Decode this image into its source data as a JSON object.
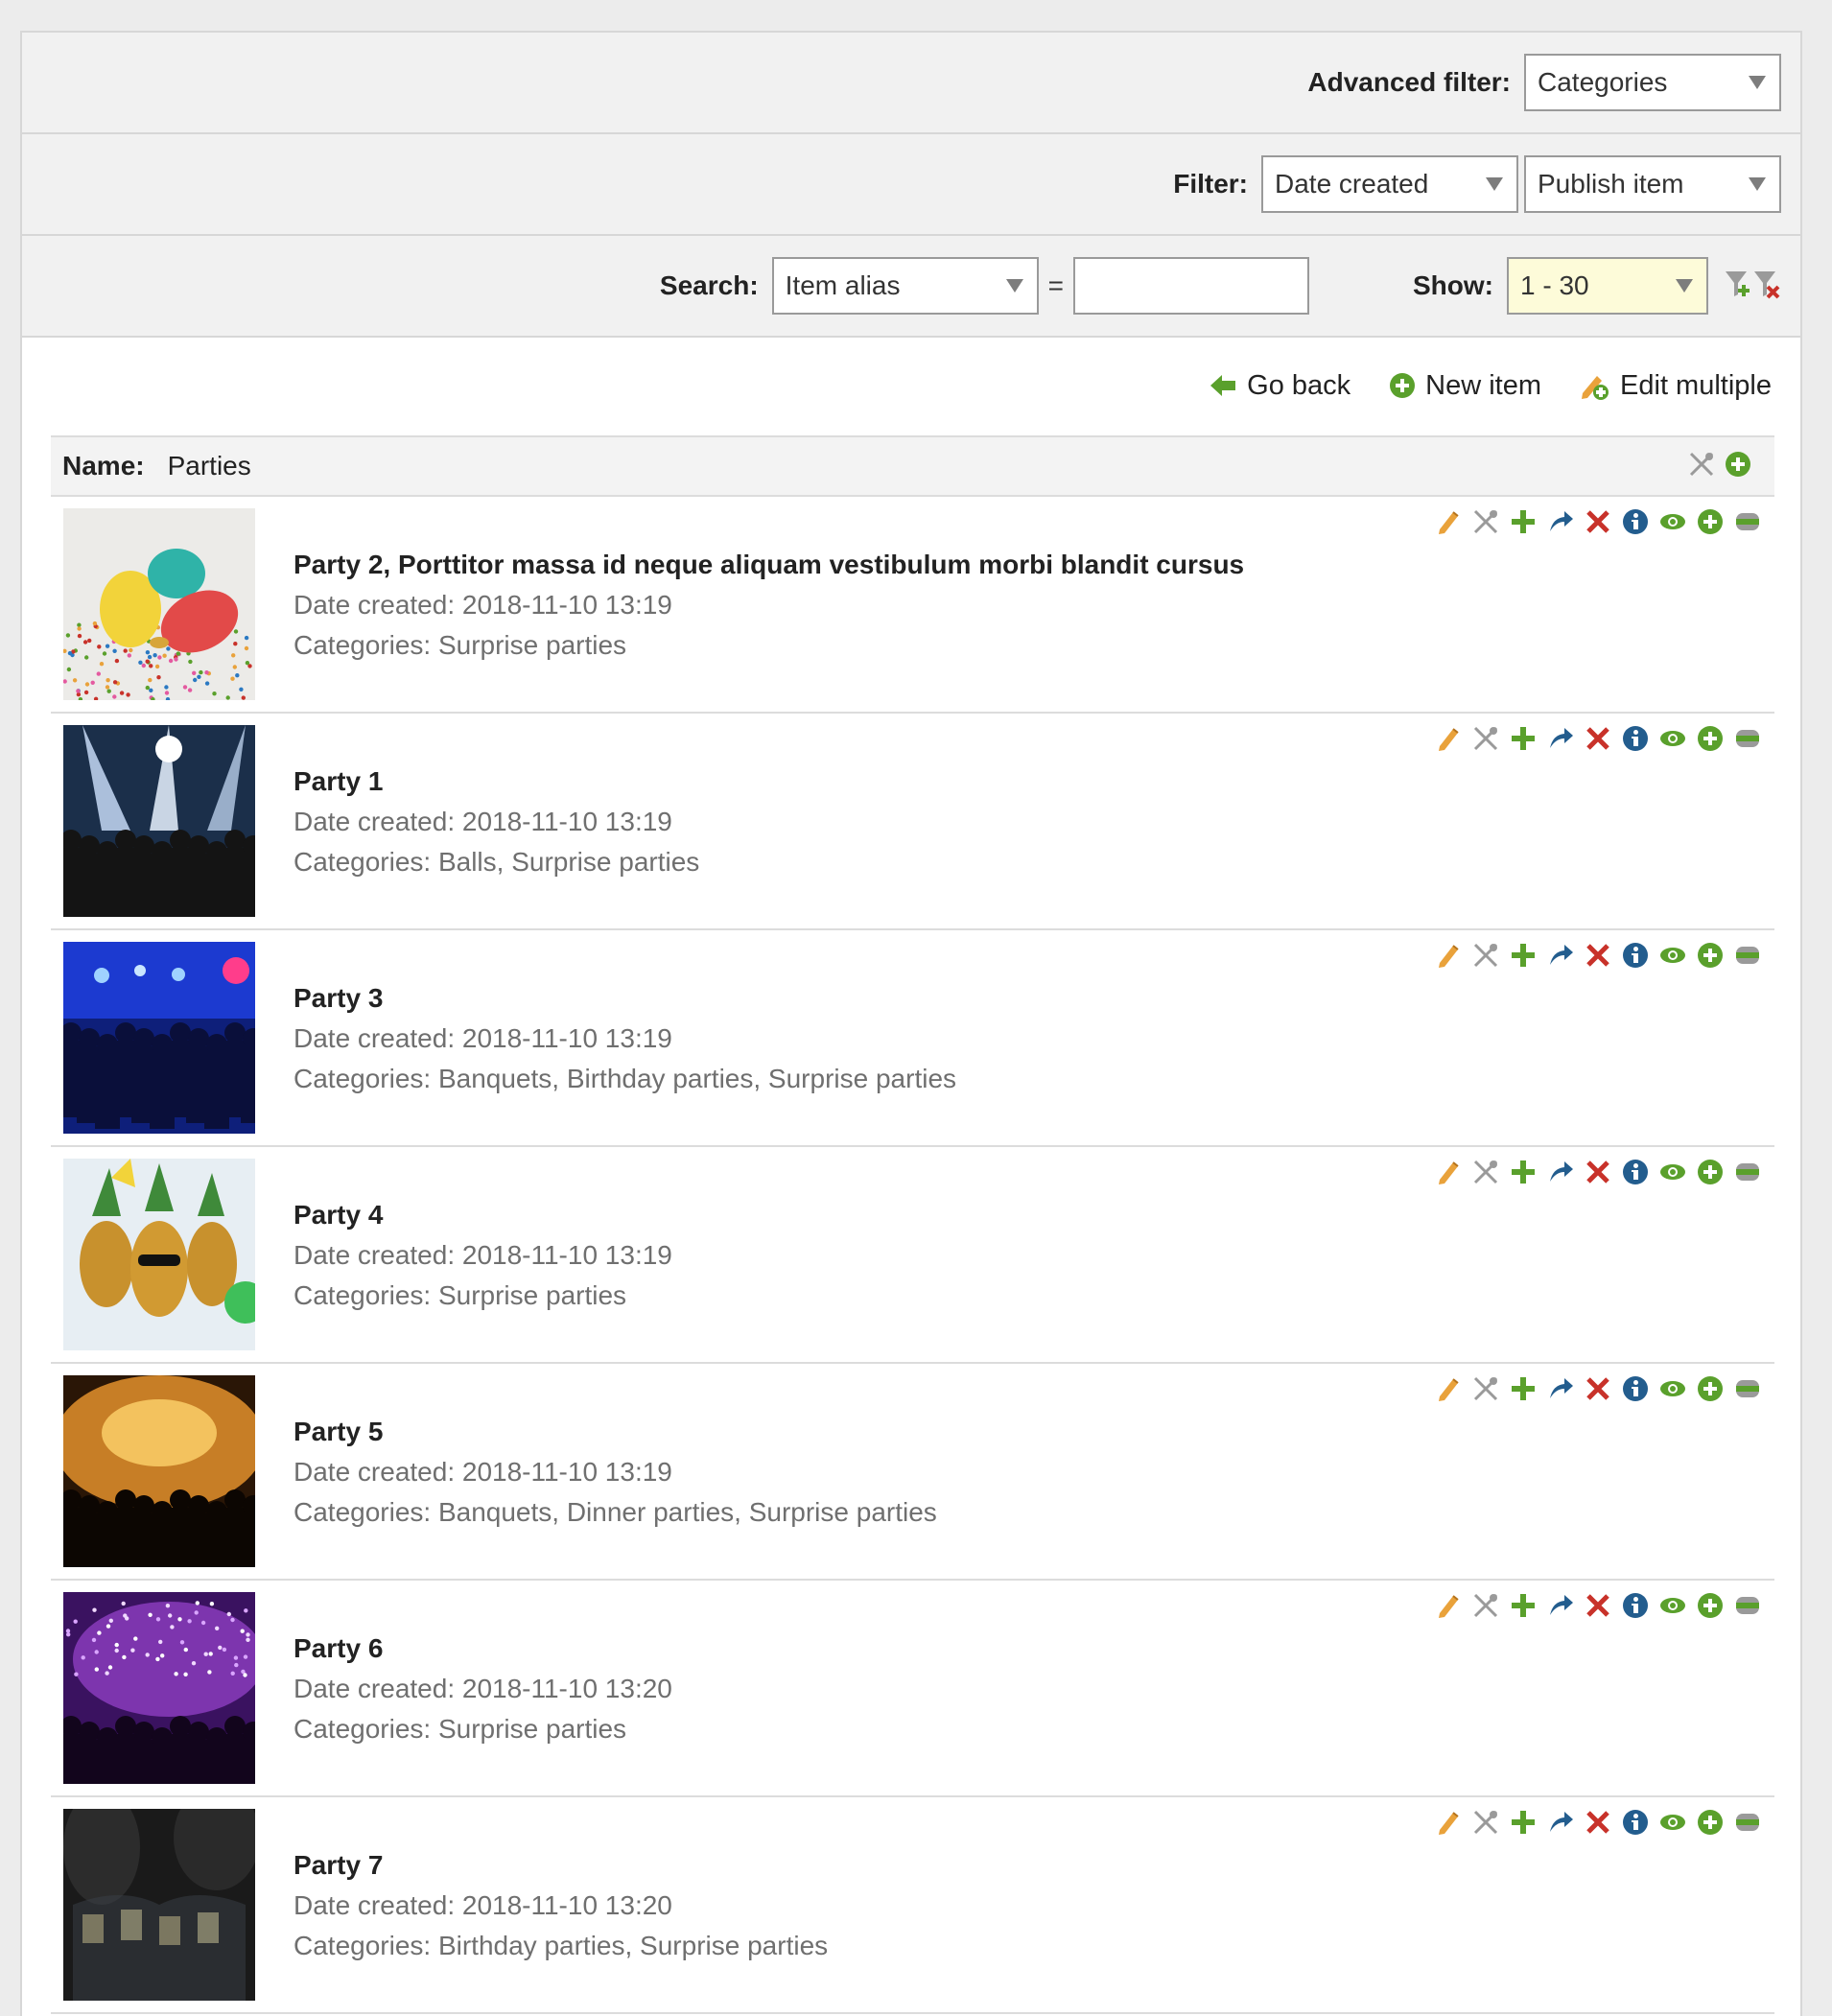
{
  "filters": {
    "advanced_label": "Advanced filter:",
    "advanced_value": "Categories",
    "filter_label": "Filter:",
    "filter_value_1": "Date created",
    "filter_value_2": "Publish item",
    "search_label": "Search:",
    "search_field": "Item alias",
    "equals": "=",
    "search_value": "",
    "show_label": "Show:",
    "show_value": "1 - 30"
  },
  "toolbar": {
    "go_back": "Go back",
    "new_item": "New item",
    "edit_multiple": "Edit multiple"
  },
  "header": {
    "name_label": "Name:",
    "name_value": "Parties"
  },
  "colors": {
    "green": "#5aa02c",
    "blue": "#235d8e",
    "red": "#c8322a",
    "orange": "#e9a23b",
    "gray": "#9a9a9a",
    "show_bg": "#fdfbd9"
  },
  "row_icons": [
    "pencil-icon",
    "tools-icon",
    "plus-icon",
    "move-arrow-icon",
    "delete-icon",
    "info-icon",
    "eye-icon",
    "add-circle-icon",
    "minus-bar-icon"
  ],
  "items": [
    {
      "title": "Party 2, Porttitor massa id neque aliquam vestibulum morbi blandit cursus",
      "date": "Date created: 2018-11-10 13:19",
      "categories": "Categories: Surprise parties",
      "thumb": "balloons"
    },
    {
      "title": "Party 1",
      "date": "Date created: 2018-11-10 13:19",
      "categories": "Categories: Balls, Surprise parties",
      "thumb": "concert-white"
    },
    {
      "title": "Party 3",
      "date": "Date created: 2018-11-10 13:19",
      "categories": "Categories: Banquets, Birthday parties, Surprise parties",
      "thumb": "club-blue"
    },
    {
      "title": "Party 4",
      "date": "Date created: 2018-11-10 13:19",
      "categories": "Categories: Surprise parties",
      "thumb": "pineapples"
    },
    {
      "title": "Party 5",
      "date": "Date created: 2018-11-10 13:19",
      "categories": "Categories: Banquets, Dinner parties, Surprise parties",
      "thumb": "concert-orange"
    },
    {
      "title": "Party 6",
      "date": "Date created: 2018-11-10 13:20",
      "categories": "Categories: Surprise parties",
      "thumb": "concert-purple"
    },
    {
      "title": "Party 7",
      "date": "Date created: 2018-11-10 13:20",
      "categories": "Categories: Birthday parties, Surprise parties",
      "thumb": "drinks"
    }
  ]
}
